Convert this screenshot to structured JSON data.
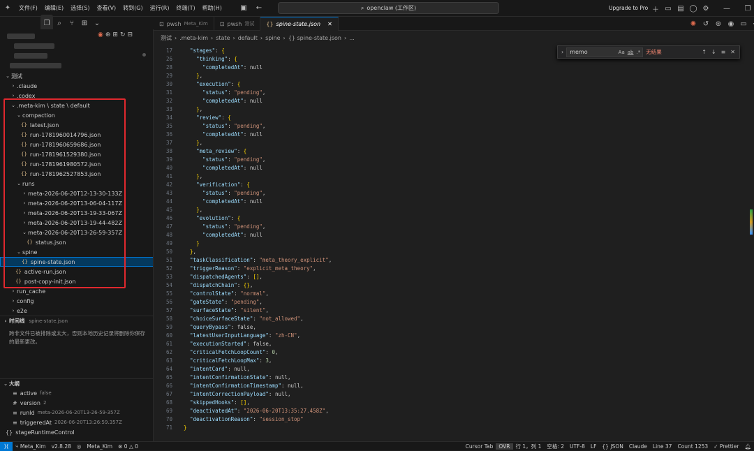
{
  "menu": [
    "文件(F)",
    "编辑(E)",
    "选择(S)",
    "查看(V)",
    "转到(G)",
    "运行(R)",
    "终端(T)",
    "帮助(H)"
  ],
  "search_box": "openclaw (工作区)",
  "upgrade": "Upgrade to Pro",
  "tabs": [
    {
      "label": "pwsh",
      "desc": "Meta_Kim"
    },
    {
      "label": "pwsh",
      "desc": "测试"
    },
    {
      "label": "spine-state.json",
      "desc": ""
    }
  ],
  "breadcrumb": [
    "测试",
    ".meta-kim",
    "state",
    "default",
    "spine",
    "{} spine-state.json",
    "..."
  ],
  "find": {
    "value": "memo",
    "case": "Aa",
    "word": "ab",
    "regex": ".*",
    "result": "无结果"
  },
  "tree": [
    {
      "label": "测试",
      "indent": 0,
      "chev": "v",
      "icon": ""
    },
    {
      "label": ".claude",
      "indent": 1,
      "chev": ">",
      "icon": ""
    },
    {
      "label": ".codex",
      "indent": 1,
      "chev": ">",
      "icon": ""
    },
    {
      "label": ".meta-kim \\ state \\ default",
      "indent": 1,
      "chev": "v",
      "icon": ""
    },
    {
      "label": "compaction",
      "indent": 2,
      "chev": "v",
      "icon": ""
    },
    {
      "label": "latest.json",
      "indent": 3,
      "chev": "",
      "icon": "{}"
    },
    {
      "label": "run-1781960014796.json",
      "indent": 3,
      "chev": "",
      "icon": "{}"
    },
    {
      "label": "run-1781960659686.json",
      "indent": 3,
      "chev": "",
      "icon": "{}"
    },
    {
      "label": "run-1781961529380.json",
      "indent": 3,
      "chev": "",
      "icon": "{}"
    },
    {
      "label": "run-1781961980572.json",
      "indent": 3,
      "chev": "",
      "icon": "{}"
    },
    {
      "label": "run-1781962527853.json",
      "indent": 3,
      "chev": "",
      "icon": "{}"
    },
    {
      "label": "runs",
      "indent": 2,
      "chev": "v",
      "icon": ""
    },
    {
      "label": "meta-2026-06-20T12-13-30-133Z",
      "indent": 3,
      "chev": ">",
      "icon": ""
    },
    {
      "label": "meta-2026-06-20T13-06-04-117Z",
      "indent": 3,
      "chev": ">",
      "icon": ""
    },
    {
      "label": "meta-2026-06-20T13-19-33-067Z",
      "indent": 3,
      "chev": ">",
      "icon": ""
    },
    {
      "label": "meta-2026-06-20T13-19-44-482Z",
      "indent": 3,
      "chev": ">",
      "icon": ""
    },
    {
      "label": "meta-2026-06-20T13-26-59-357Z",
      "indent": 3,
      "chev": "v",
      "icon": ""
    },
    {
      "label": "status.json",
      "indent": 4,
      "chev": "",
      "icon": "{}"
    },
    {
      "label": "spine",
      "indent": 2,
      "chev": "v",
      "icon": ""
    },
    {
      "label": "spine-state.json",
      "indent": 3,
      "chev": "",
      "icon": "{}",
      "selected": true
    },
    {
      "label": "active-run.json",
      "indent": 2,
      "chev": "",
      "icon": "{}"
    },
    {
      "label": "post-copy-init.json",
      "indent": 2,
      "chev": "",
      "icon": "{}"
    },
    {
      "label": "run_cache",
      "indent": 1,
      "chev": ">",
      "icon": ""
    },
    {
      "label": "config",
      "indent": 1,
      "chev": ">",
      "icon": ""
    },
    {
      "label": "e2e",
      "indent": 1,
      "chev": ">",
      "icon": ""
    }
  ],
  "timeline": {
    "title": "时间线",
    "file": "spine-state.json",
    "text": "跨非文件已被排除或太大，否则本地历史记录将删除你保存的最新更改。"
  },
  "outline": {
    "title": "大纲",
    "items": [
      {
        "icon": "≡",
        "key": "active",
        "val": "false"
      },
      {
        "icon": "#",
        "key": "version",
        "val": "2"
      },
      {
        "icon": "≡",
        "key": "runId",
        "val": "meta-2026-06-20T13-26-59-357Z"
      },
      {
        "icon": "≡",
        "key": "triggeredAt",
        "val": "2026-06-20T13:26:59.357Z"
      },
      {
        "icon": "{}",
        "key": "stageRuntimeControl",
        "val": ""
      }
    ]
  },
  "code": [
    {
      "n": 17,
      "t": "  \"stages\": {"
    },
    {
      "n": 26,
      "t": "    \"thinking\": {"
    },
    {
      "n": 28,
      "t": "      \"completedAt\": null"
    },
    {
      "n": 29,
      "t": "    },"
    },
    {
      "n": 30,
      "t": "    \"execution\": {"
    },
    {
      "n": 31,
      "t": "      \"status\": \"pending\","
    },
    {
      "n": 32,
      "t": "      \"completedAt\": null"
    },
    {
      "n": 33,
      "t": "    },"
    },
    {
      "n": 34,
      "t": "    \"review\": {"
    },
    {
      "n": 35,
      "t": "      \"status\": \"pending\","
    },
    {
      "n": 36,
      "t": "      \"completedAt\": null"
    },
    {
      "n": 37,
      "t": "    },"
    },
    {
      "n": 38,
      "t": "    \"meta_review\": {"
    },
    {
      "n": 39,
      "t": "      \"status\": \"pending\","
    },
    {
      "n": 40,
      "t": "      \"completedAt\": null"
    },
    {
      "n": 41,
      "t": "    },"
    },
    {
      "n": 42,
      "t": "    \"verification\": {"
    },
    {
      "n": 43,
      "t": "      \"status\": \"pending\","
    },
    {
      "n": 44,
      "t": "      \"completedAt\": null"
    },
    {
      "n": 45,
      "t": "    },"
    },
    {
      "n": 46,
      "t": "    \"evolution\": {"
    },
    {
      "n": 47,
      "t": "      \"status\": \"pending\","
    },
    {
      "n": 48,
      "t": "      \"completedAt\": null"
    },
    {
      "n": 49,
      "t": "    }"
    },
    {
      "n": 50,
      "t": "  },"
    },
    {
      "n": 51,
      "t": "  \"taskClassification\": \"meta_theory_explicit\","
    },
    {
      "n": 52,
      "t": "  \"triggerReason\": \"explicit_meta_theory\","
    },
    {
      "n": 53,
      "t": "  \"dispatchedAgents\": [],"
    },
    {
      "n": 54,
      "t": "  \"dispatchChain\": {},"
    },
    {
      "n": 55,
      "t": "  \"controlState\": \"normal\","
    },
    {
      "n": 56,
      "t": "  \"gateState\": \"pending\","
    },
    {
      "n": 57,
      "t": "  \"surfaceState\": \"silent\","
    },
    {
      "n": 58,
      "t": "  \"choiceSurfaceState\": \"not_allowed\","
    },
    {
      "n": 59,
      "t": "  \"queryBypass\": false,"
    },
    {
      "n": 60,
      "t": "  \"latestUserInputLanguage\": \"zh-CN\","
    },
    {
      "n": 61,
      "t": "  \"executionStarted\": false,"
    },
    {
      "n": 62,
      "t": "  \"criticalFetchLoopCount\": 0,"
    },
    {
      "n": 63,
      "t": "  \"criticalFetchLoopMax\": 3,"
    },
    {
      "n": 64,
      "t": "  \"intentCard\": null,"
    },
    {
      "n": 65,
      "t": "  \"intentConfirmationState\": null,"
    },
    {
      "n": 66,
      "t": "  \"intentConfirmationTimestamp\": null,"
    },
    {
      "n": 67,
      "t": "  \"intentCorrectionPayload\": null,"
    },
    {
      "n": 68,
      "t": "  \"skippedHooks\": [],"
    },
    {
      "n": 69,
      "t": "  \"deactivatedAt\": \"2026-06-20T13:35:27.458Z\","
    },
    {
      "n": 70,
      "t": "  \"deactivationReason\": \"session_stop\""
    },
    {
      "n": 71,
      "t": "}"
    }
  ],
  "status": {
    "branch": "Meta_Kim",
    "version": "v2.8.28",
    "project": "Meta_Kim",
    "problems": "0",
    "warnings": "0",
    "cursor_tab": "Cursor Tab",
    "ovr": "OVR",
    "pos": "行 1，列 1",
    "spaces": "空格: 2",
    "enc": "UTF-8",
    "eol": "LF",
    "lang": "JSON",
    "model": "Claude",
    "line": "Line 37",
    "count": "Count 1253",
    "prettier": "Prettier"
  },
  "colors": {
    "accent": "#0078d4",
    "highlight": "#e0282e",
    "selection": "#04395e"
  }
}
